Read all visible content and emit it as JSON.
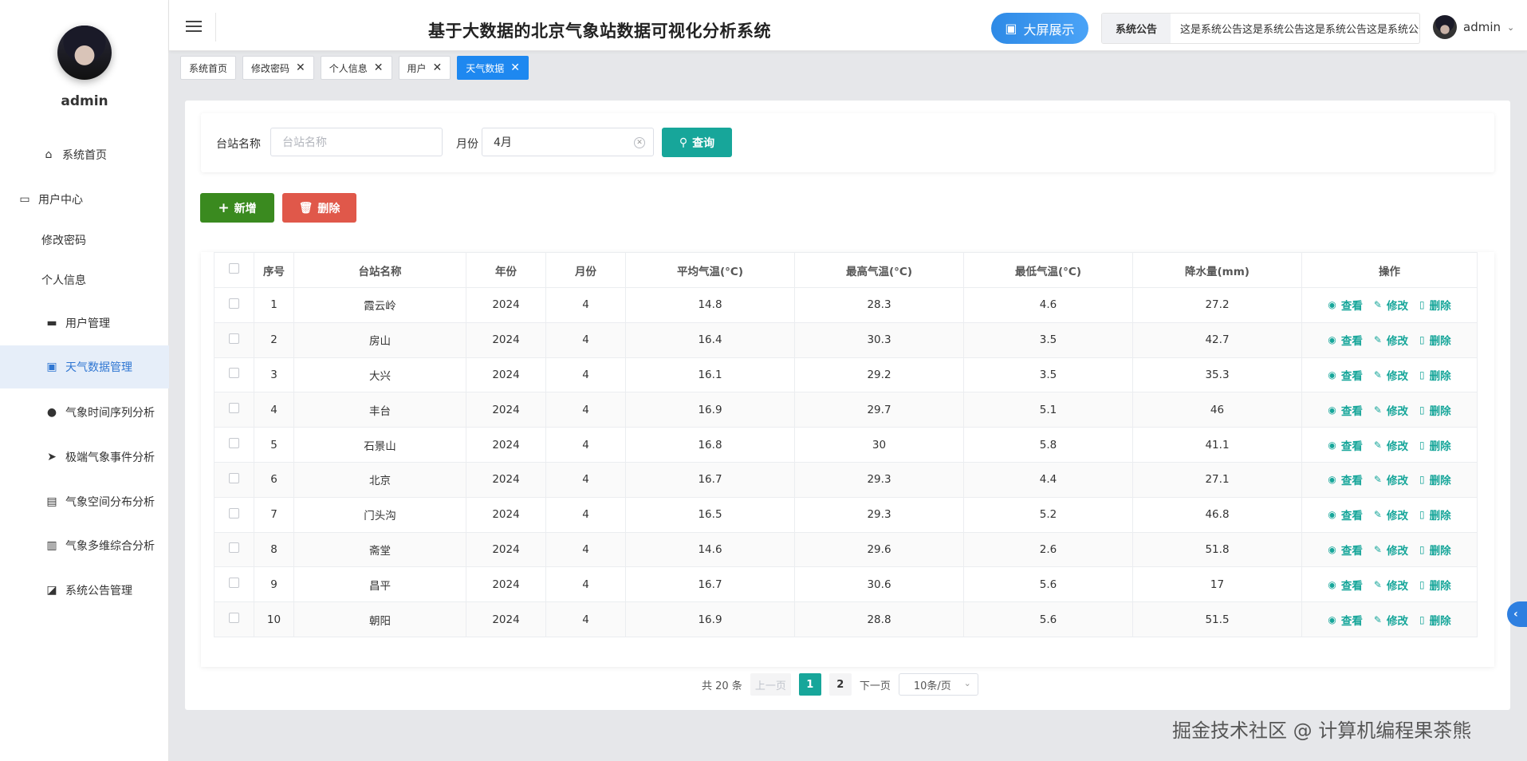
{
  "sidebar": {
    "username": "admin",
    "items": [
      {
        "label": "系统首页",
        "icon": "home-icon",
        "glyph": "⌂"
      },
      {
        "label": "用户中心",
        "icon": "wallet-icon",
        "glyph": "▭"
      },
      {
        "label": "修改密码"
      },
      {
        "label": "个人信息"
      },
      {
        "label": "用户管理",
        "icon": "ticket-icon",
        "glyph": "▬"
      },
      {
        "label": "天气数据管理",
        "icon": "clipboard-icon",
        "glyph": "▣"
      },
      {
        "label": "气象时间序列分析",
        "icon": "user-icon",
        "glyph": "●"
      },
      {
        "label": "极端气象事件分析",
        "icon": "send-icon",
        "glyph": "➤"
      },
      {
        "label": "气象空间分布分析",
        "icon": "chat-icon",
        "glyph": "▤"
      },
      {
        "label": "气象多维综合分析",
        "icon": "bar-chart-icon",
        "glyph": "▥"
      },
      {
        "label": "系统公告管理",
        "icon": "line-chart-icon",
        "glyph": "◪"
      }
    ]
  },
  "header": {
    "title": "基于大数据的北京气象站数据可视化分析系统",
    "big_screen_label": "大屏展示",
    "notice_label": "系统公告",
    "notice_text": "这是系统公告这是系统公告这是系统公告这是系统公告",
    "username": "admin"
  },
  "tags": [
    {
      "label": "系统首页",
      "closable": false,
      "active": false
    },
    {
      "label": "修改密码",
      "closable": true,
      "active": false
    },
    {
      "label": "个人信息",
      "closable": true,
      "active": false
    },
    {
      "label": "用户",
      "closable": true,
      "active": false
    },
    {
      "label": "天气数据",
      "closable": true,
      "active": true
    }
  ],
  "search": {
    "station_label": "台站名称",
    "station_placeholder": "台站名称",
    "station_value": "",
    "month_label": "月份",
    "month_value": "4月",
    "query_label": "查询"
  },
  "actions": {
    "add_label": "新增",
    "delete_label": "删除"
  },
  "table": {
    "columns": [
      "序号",
      "台站名称",
      "年份",
      "月份",
      "平均气温(°C)",
      "最高气温(°C)",
      "最低气温(°C)",
      "降水量(mm)",
      "操作"
    ],
    "row_actions": {
      "view": "查看",
      "edit": "修改",
      "delete": "删除"
    },
    "rows": [
      [
        "1",
        "霞云岭",
        "2024",
        "4",
        "14.8",
        "28.3",
        "4.6",
        "27.2"
      ],
      [
        "2",
        "房山",
        "2024",
        "4",
        "16.4",
        "30.3",
        "3.5",
        "42.7"
      ],
      [
        "3",
        "大兴",
        "2024",
        "4",
        "16.1",
        "29.2",
        "3.5",
        "35.3"
      ],
      [
        "4",
        "丰台",
        "2024",
        "4",
        "16.9",
        "29.7",
        "5.1",
        "46"
      ],
      [
        "5",
        "石景山",
        "2024",
        "4",
        "16.8",
        "30",
        "5.8",
        "41.1"
      ],
      [
        "6",
        "北京",
        "2024",
        "4",
        "16.7",
        "29.3",
        "4.4",
        "27.1"
      ],
      [
        "7",
        "门头沟",
        "2024",
        "4",
        "16.5",
        "29.3",
        "5.2",
        "46.8"
      ],
      [
        "8",
        "斋堂",
        "2024",
        "4",
        "14.6",
        "29.6",
        "2.6",
        "51.8"
      ],
      [
        "9",
        "昌平",
        "2024",
        "4",
        "16.7",
        "30.6",
        "5.6",
        "17"
      ],
      [
        "10",
        "朝阳",
        "2024",
        "4",
        "16.9",
        "28.8",
        "5.6",
        "51.5"
      ]
    ]
  },
  "pagination": {
    "total_text": "共 20 条",
    "prev_label": "上一页",
    "pages": [
      "1",
      "2"
    ],
    "current_page": "1",
    "next_label": "下一页",
    "page_size": "10条/页"
  },
  "watermark": "掘金技术社区 @ 计算机编程果茶熊",
  "colors": {
    "primary": "#17a69a",
    "active_tag": "#1e88f0",
    "add_button": "#3a8a1f",
    "delete_button": "#e0584a",
    "menu_active": "#2f76d2"
  }
}
